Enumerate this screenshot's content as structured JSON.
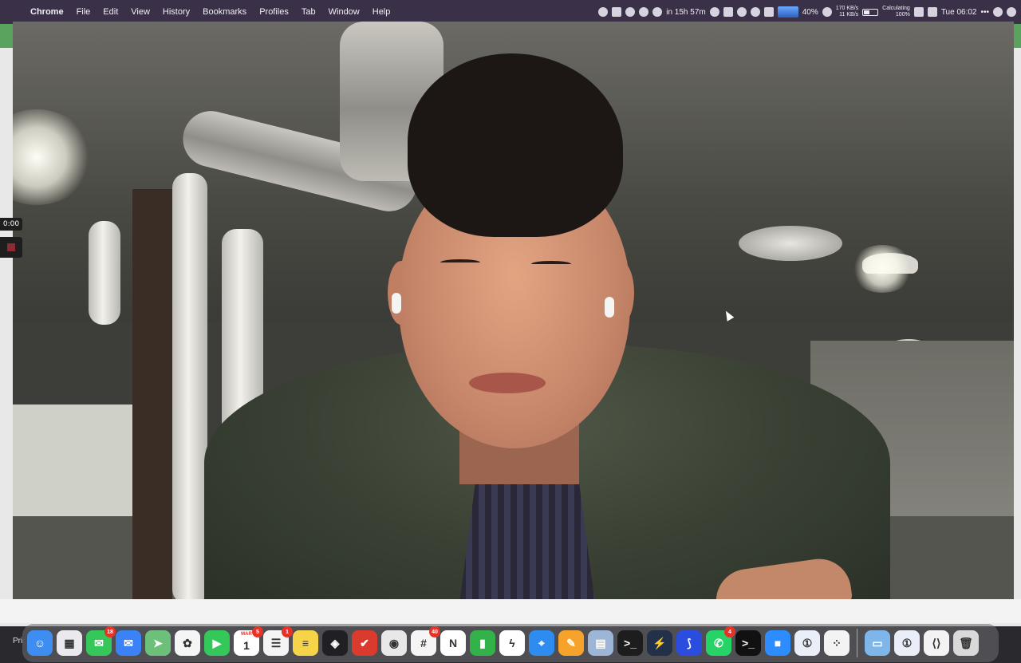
{
  "menubar": {
    "app_name": "Chrome",
    "menus": [
      "File",
      "Edit",
      "View",
      "History",
      "Bookmarks",
      "Profiles",
      "Tab",
      "Window",
      "Help"
    ],
    "status": {
      "timer": "in 15h 57m",
      "battery_percent": "40%",
      "net_up": "170 KB/s",
      "net_down": "11 KB/s",
      "calc_line1": "Calculating",
      "calc_line2": "100%",
      "clock": "Tue 06:02"
    }
  },
  "recorder": {
    "time": "0:00"
  },
  "bottom": {
    "text": "Pri"
  },
  "dock": {
    "apps": [
      {
        "name": "Finder",
        "icon": "finder-icon",
        "color": "#3d8ef0",
        "glyph": "☺"
      },
      {
        "name": "Launchpad",
        "icon": "launchpad-icon",
        "color": "#e9e9ee",
        "glyph": "▦"
      },
      {
        "name": "Messages",
        "icon": "messages-icon",
        "color": "#35c759",
        "glyph": "✉",
        "badge": "18"
      },
      {
        "name": "Mail",
        "icon": "mail-icon",
        "color": "#3b82f6",
        "glyph": "✉"
      },
      {
        "name": "Maps",
        "icon": "maps-icon",
        "color": "#6cc07a",
        "glyph": "➤"
      },
      {
        "name": "Photos",
        "icon": "photos-icon",
        "color": "#f5f5f5",
        "glyph": "✿"
      },
      {
        "name": "FaceTime",
        "icon": "facetime-icon",
        "color": "#34c759",
        "glyph": "▶"
      },
      {
        "name": "Calendar",
        "icon": "calendar-icon",
        "color": "#ffffff",
        "cal_month": "MAR",
        "cal_day": "1",
        "badge": "5"
      },
      {
        "name": "Reminders",
        "icon": "reminders-icon",
        "color": "#f4f4f4",
        "glyph": "☰",
        "badge": "1"
      },
      {
        "name": "Notes",
        "icon": "notes-icon",
        "color": "#f6d44a",
        "glyph": "≡"
      },
      {
        "name": "Linear",
        "icon": "layers-icon",
        "color": "#1f1f24",
        "glyph": "◈"
      },
      {
        "name": "Todoist",
        "icon": "checkmark-icon",
        "color": "#db3b2f",
        "glyph": "✔"
      },
      {
        "name": "Chrome",
        "icon": "chrome-icon",
        "color": "#e8e8e8",
        "glyph": "◉"
      },
      {
        "name": "Slack",
        "icon": "slack-icon",
        "color": "#f5f5f5",
        "glyph": "#",
        "badge": "40"
      },
      {
        "name": "Notion",
        "icon": "notion-icon",
        "color": "#ffffff",
        "glyph": "N"
      },
      {
        "name": "Numbers",
        "icon": "numbers-icon",
        "color": "#34b24a",
        "glyph": "▮"
      },
      {
        "name": "Messenger",
        "icon": "messenger-icon",
        "color": "#ffffff",
        "glyph": "ϟ"
      },
      {
        "name": "Safari",
        "icon": "safari-icon",
        "color": "#2e8bf0",
        "glyph": "⌖"
      },
      {
        "name": "Pages",
        "icon": "pencil-icon",
        "color": "#f7a32b",
        "glyph": "✎"
      },
      {
        "name": "Preview",
        "icon": "preview-icon",
        "color": "#9db6d8",
        "glyph": "▤"
      },
      {
        "name": "Terminal",
        "icon": "terminal-icon",
        "color": "#1d1d1d",
        "glyph": ">_"
      },
      {
        "name": "Reeder",
        "icon": "bolt-icon",
        "color": "#22304a",
        "glyph": "⚡"
      },
      {
        "name": "Framer",
        "icon": "framer-icon",
        "color": "#2a4de0",
        "glyph": "⟆"
      },
      {
        "name": "WhatsApp",
        "icon": "whatsapp-icon",
        "color": "#25d366",
        "glyph": "✆",
        "badge": "4"
      },
      {
        "name": "Terminal 2",
        "icon": "console-icon",
        "color": "#111111",
        "glyph": ">_"
      },
      {
        "name": "Zoom",
        "icon": "zoom-icon",
        "color": "#2d8cff",
        "glyph": "■"
      },
      {
        "name": "1Password",
        "icon": "onepassword-icon",
        "color": "#e9eef8",
        "glyph": "①"
      },
      {
        "name": "Tailscale",
        "icon": "tailscale-icon",
        "color": "#f3f3f3",
        "glyph": "⁘"
      },
      {
        "name": "Downloads",
        "icon": "folder-icon",
        "color": "#7fb6ea",
        "glyph": "▭"
      },
      {
        "name": "1Password 2",
        "icon": "onepassword-icon-2",
        "color": "#e9eef8",
        "glyph": "①"
      },
      {
        "name": "VS Code",
        "icon": "vscode-icon",
        "color": "#f3f3f3",
        "glyph": "⟨⟩"
      },
      {
        "name": "Trash",
        "icon": "trash-icon",
        "color": "#d9d9d9",
        "glyph": "🗑"
      }
    ]
  }
}
